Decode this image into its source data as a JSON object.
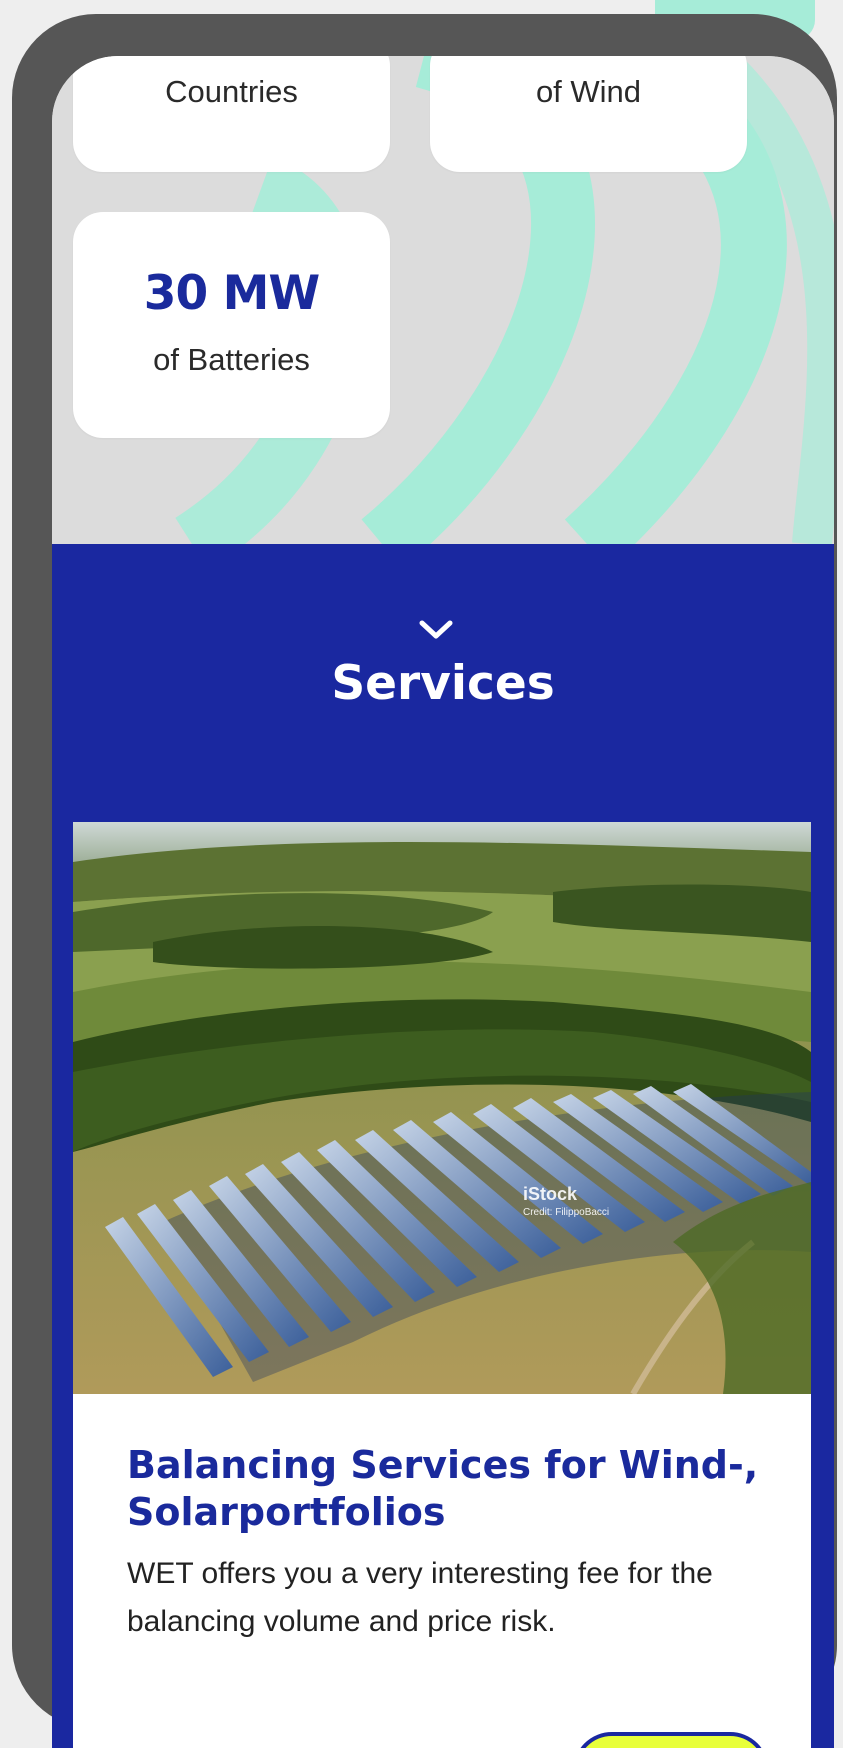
{
  "stats": [
    {
      "label": "Countries"
    },
    {
      "label": "of Wind"
    },
    {
      "value": "30 MW",
      "label": "of Batteries"
    }
  ],
  "services": {
    "section_title": "Services",
    "card": {
      "title": "Balancing Services for Wind-, Solarportfolios",
      "description": "WET offers you a very interesting fee for the balancing volume and price risk.",
      "image_watermark": "iStock",
      "image_credit": "Credit: FilippoBacci"
    }
  },
  "icons": {
    "expand": "chevron-down-icon"
  },
  "colors": {
    "brand_blue": "#1a28a0",
    "accent_mint": "#a6ecd8",
    "cta_yellow": "#e8ff3a",
    "stats_background": "#dcdcdc",
    "device_frame": "#565656"
  }
}
